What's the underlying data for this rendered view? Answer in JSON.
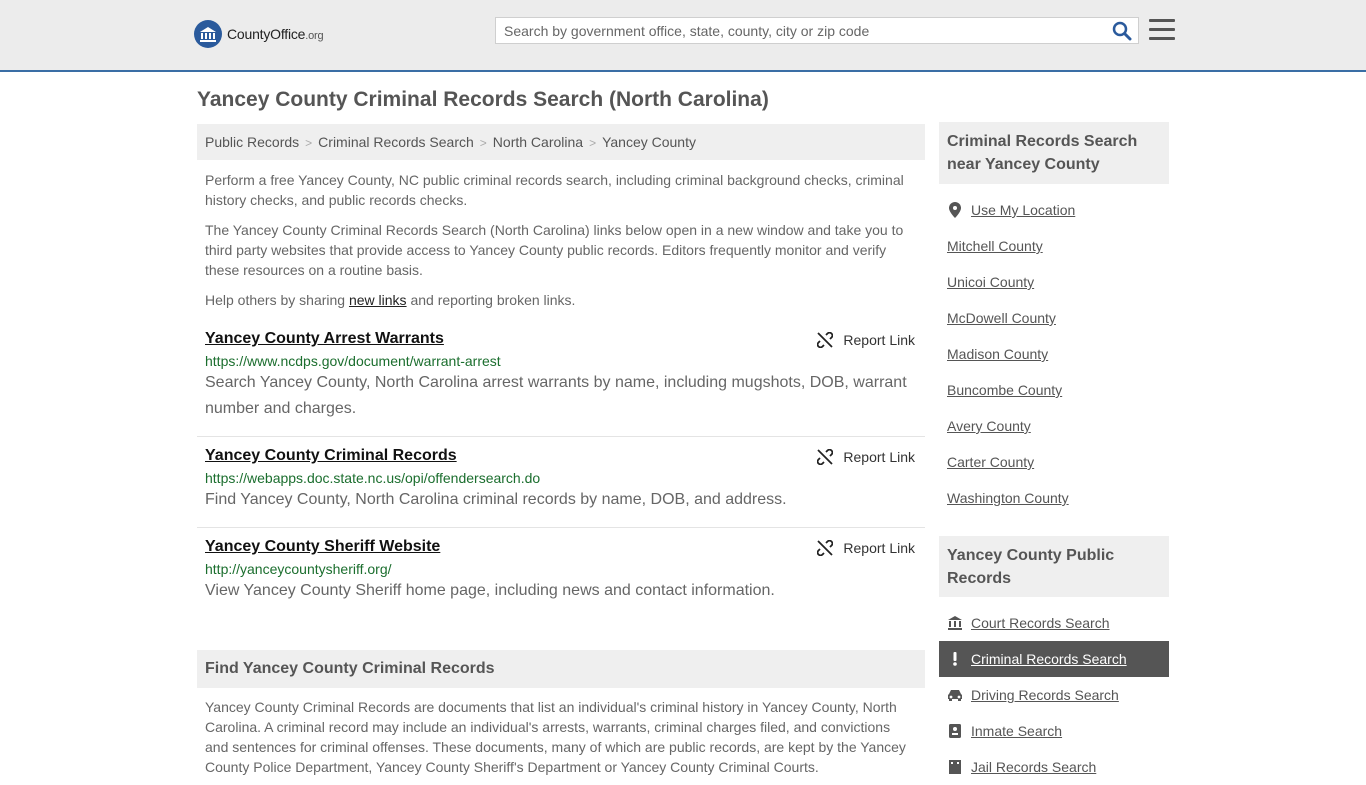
{
  "header": {
    "logo_main": "CountyOffice",
    "logo_suffix": ".org",
    "search_placeholder": "Search by government office, state, county, city or zip code"
  },
  "page_title": "Yancey County Criminal Records Search (North Carolina)",
  "breadcrumb": [
    "Public Records",
    "Criminal Records Search",
    "North Carolina",
    "Yancey County"
  ],
  "intro": {
    "p1": "Perform a free Yancey County, NC public criminal records search, including criminal background checks, criminal history checks, and public records checks.",
    "p2": "The Yancey County Criminal Records Search (North Carolina) links below open in a new window and take you to third party websites that provide access to Yancey County public records. Editors frequently monitor and verify these resources on a routine basis.",
    "p3_before": "Help others by sharing ",
    "p3_link": "new links",
    "p3_after": " and reporting broken links."
  },
  "report_label": "Report Link",
  "results": [
    {
      "title": "Yancey County Arrest Warrants",
      "url": "https://www.ncdps.gov/document/warrant-arrest",
      "desc": "Search Yancey County, North Carolina arrest warrants by name, including mugshots, DOB, warrant number and charges."
    },
    {
      "title": "Yancey County Criminal Records",
      "url": "https://webapps.doc.state.nc.us/opi/offendersearch.do",
      "desc": "Find Yancey County, North Carolina criminal records by name, DOB, and address."
    },
    {
      "title": "Yancey County Sheriff Website",
      "url": "http://yanceycountysheriff.org/",
      "desc": "View Yancey County Sheriff home page, including news and contact information."
    }
  ],
  "find_section": {
    "heading": "Find Yancey County Criminal Records",
    "text": "Yancey County Criminal Records are documents that list an individual's criminal history in Yancey County, North Carolina. A criminal record may include an individual's arrests, warrants, criminal charges filed, and convictions and sentences for criminal offenses. These documents, many of which are public records, are kept by the Yancey County Police Department, Yancey County Sheriff's Department or Yancey County Criminal Courts."
  },
  "sidebar": {
    "nearby_heading": "Criminal Records Search near Yancey County",
    "use_location": "Use My Location",
    "nearby": [
      "Mitchell County",
      "Unicoi County",
      "McDowell County",
      "Madison County",
      "Buncombe County",
      "Avery County",
      "Carter County",
      "Washington County"
    ],
    "public_heading": "Yancey County Public Records",
    "public_records": [
      {
        "label": "Court Records Search",
        "icon": "courthouse-icon"
      },
      {
        "label": "Criminal Records Search",
        "icon": "exclamation-icon"
      },
      {
        "label": "Driving Records Search",
        "icon": "car-icon"
      },
      {
        "label": "Inmate Search",
        "icon": "id-card-icon"
      },
      {
        "label": "Jail Records Search",
        "icon": "building-icon"
      }
    ]
  },
  "colors": {
    "accent_border": "#3a6ea5",
    "url_green": "#1b6e2e",
    "active_bg": "#555555",
    "search_icon": "#2a5a9c"
  }
}
